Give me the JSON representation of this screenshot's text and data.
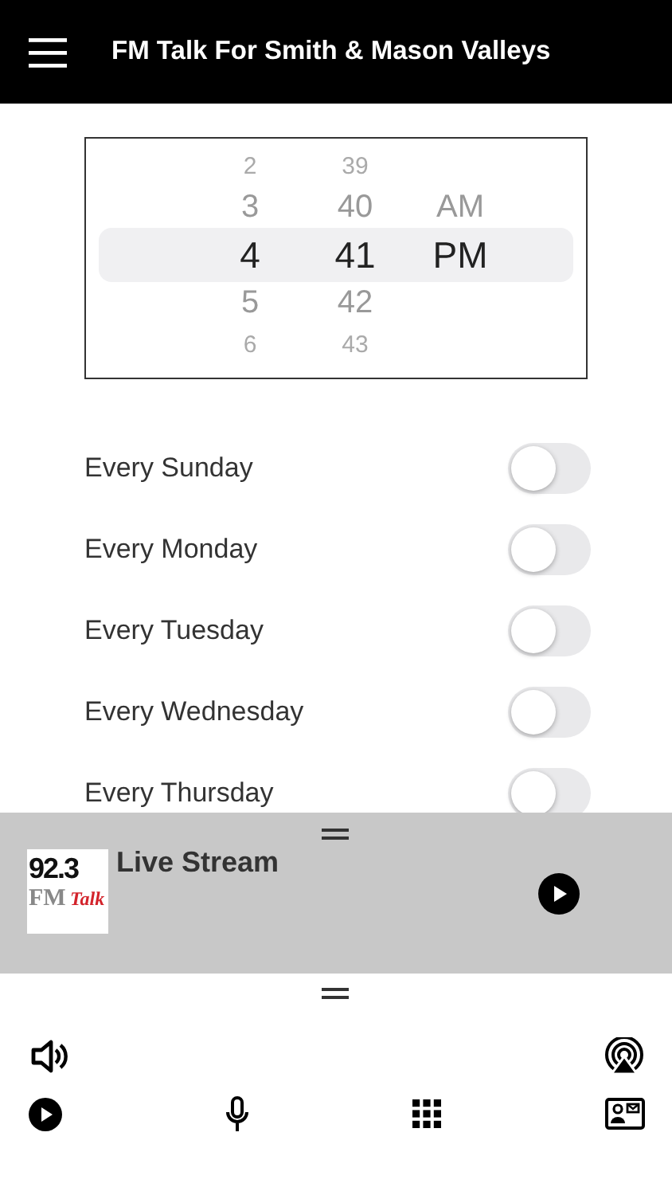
{
  "header": {
    "title": "FM Talk For Smith & Mason Valleys"
  },
  "picker": {
    "columns": [
      {
        "items": [
          {
            "label": "2",
            "selected": false
          },
          {
            "label": "3",
            "selected": false
          },
          {
            "label": "4",
            "selected": true
          },
          {
            "label": "5",
            "selected": false
          },
          {
            "label": "6",
            "selected": false
          }
        ]
      },
      {
        "items": [
          {
            "label": "39",
            "selected": false
          },
          {
            "label": "40",
            "selected": false
          },
          {
            "label": "41",
            "selected": true
          },
          {
            "label": "42",
            "selected": false
          },
          {
            "label": "43",
            "selected": false
          }
        ]
      },
      {
        "items": [
          {
            "label": "AM",
            "selected": false
          },
          {
            "label": "PM",
            "selected": true
          }
        ]
      }
    ]
  },
  "repeat": [
    {
      "label": "Every Sunday",
      "on": false
    },
    {
      "label": "Every Monday",
      "on": false
    },
    {
      "label": "Every Tuesday",
      "on": false
    },
    {
      "label": "Every Wednesday",
      "on": false
    },
    {
      "label": "Every Thursday",
      "on": false
    }
  ],
  "player": {
    "title": "Live Stream",
    "logo": {
      "number": "92.3",
      "band": "FM",
      "word": "Talk"
    },
    "playing": false
  },
  "controls": [
    {
      "kind": "volume"
    },
    {
      "kind": "cast"
    },
    {
      "kind": "play"
    },
    {
      "kind": "mic"
    },
    {
      "kind": "grid"
    },
    {
      "kind": "contact"
    }
  ]
}
